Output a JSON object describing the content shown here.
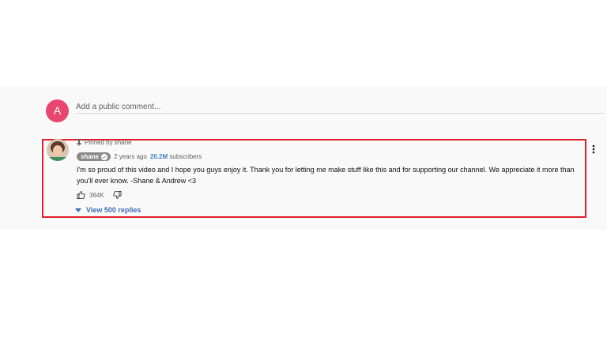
{
  "comment_box": {
    "avatar_letter": "A",
    "placeholder": "Add a public comment..."
  },
  "comment": {
    "pinned_label": "Pinned by shane",
    "author": "shane",
    "timestamp": "2 years ago",
    "subscriber_count": "20.2M",
    "subscriber_label": "subscribers",
    "text": "I'm so proud of this video and I hope you guys enjoy it. Thank you for letting me make stuff like this and for supporting our channel. We appreciate it more than you'll ever know. -Shane & Andrew <3",
    "like_count": "364K",
    "view_replies": "View 500 replies"
  },
  "colors": {
    "highlight_border": "#e0202a",
    "avatar_bg": "#e8466f",
    "link_blue": "#3e6fb5"
  },
  "icons": [
    "pin-icon",
    "verified-icon",
    "like-icon",
    "dislike-icon",
    "chevron-down-icon",
    "more-vert-icon"
  ]
}
